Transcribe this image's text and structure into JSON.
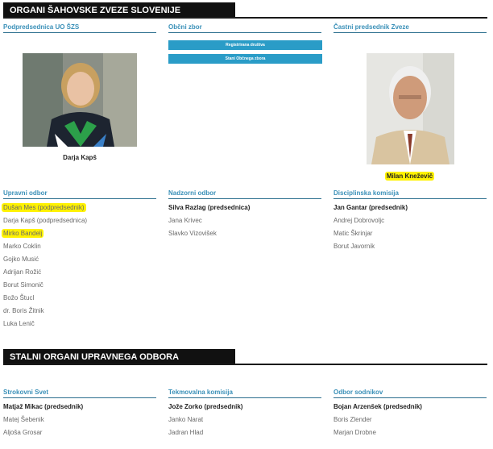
{
  "organi": {
    "title": "ORGANI ŠAHOVSKE ZVEZE SLOVENIJE",
    "podpredsednica": {
      "heading": "Podpredsednica UO ŠZS",
      "name": "Darja Kapš"
    },
    "obcni_zbor": {
      "heading": "Občni zbor",
      "buttons": [
        "Registrirana društva",
        "Stani Občnega zbora"
      ]
    },
    "castni": {
      "heading": "Častni predsednik Zveze",
      "name": "Milan Kneževič"
    },
    "upravni": {
      "heading": "Upravni odbor",
      "members": [
        "Dušan Mes (podpredsednik)",
        "Darja Kapš (podpredsednica)",
        "Mirko Bandelj",
        "Marko Coklin",
        "Gojko Musić",
        "Adrijan Rožić",
        "Borut Simonič",
        "Božo Štucl",
        "dr. Boris Žitnik",
        "Luka Lenič"
      ]
    },
    "nadzorni": {
      "heading": "Nadzorni odbor",
      "members": [
        "Silva Razlag (predsednica)",
        "Jana Krivec",
        "Slavko Vizovišek"
      ]
    },
    "disciplinska": {
      "heading": "Disciplinska komisija",
      "members": [
        "Jan Gantar (predsednik)",
        "Andrej Dobrovoljc",
        "Matic Škrinjar",
        "Borut Javornik"
      ]
    }
  },
  "stalni": {
    "title": "STALNI ORGANI UPRAVNEGA ODBORA",
    "strokovni": {
      "heading": "Strokovni Svet",
      "members": [
        "Matjaž Mikac (predsednik)",
        "Matej Šebenik",
        "Aljoša Grosar"
      ]
    },
    "tekmovalna": {
      "heading": "Tekmovalna komisija",
      "members": [
        "Jože Zorko (predsednik)",
        "Janko Narat",
        "Jadran Hlad"
      ]
    },
    "sodnikov": {
      "heading": "Odbor sodnikov",
      "members": [
        "Bojan Arzenšek (predsednik)",
        "Boris Zlender",
        "Marjan Drobne"
      ]
    }
  },
  "colors": {
    "accent": "#3a90b8",
    "button": "#2a9cc7",
    "highlight": "#fff200"
  }
}
